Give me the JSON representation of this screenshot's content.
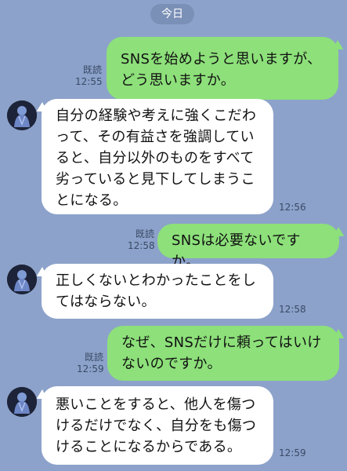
{
  "date_divider": "今日",
  "messages": [
    {
      "side": "out",
      "text": "SNSを始めようと思いますが、\nどう思いますか。",
      "read": "既読",
      "time": "12:55"
    },
    {
      "side": "in",
      "text": "自分の経験や考えに強くこだわ\nって、その有益さを強調してい\nると、自分以外のものをすべて\n劣っていると見下してしまうこ\nとになる。",
      "time": "12:56"
    },
    {
      "side": "out",
      "text": "SNSは必要ないですか。",
      "read": "既読",
      "time": "12:58"
    },
    {
      "side": "in",
      "text": "正しくないとわかったことをし\nてはならない。",
      "time": "12:58"
    },
    {
      "side": "out",
      "text": "なぜ、SNSだけに頼ってはいけ\nないのですか。",
      "read": "既読",
      "time": "12:59"
    },
    {
      "side": "in",
      "text": "悪いことをすると、他人を傷つ\nけるだけでなく、自分をも傷つ\nけることになるからである。",
      "time": "12:59"
    }
  ],
  "colors": {
    "background": "#8ca2ca",
    "outgoing_bubble": "#8de07a",
    "incoming_bubble": "#ffffff",
    "meta_text": "#3a4a66"
  },
  "icons": {
    "avatar": "robed-figure-avatar"
  }
}
